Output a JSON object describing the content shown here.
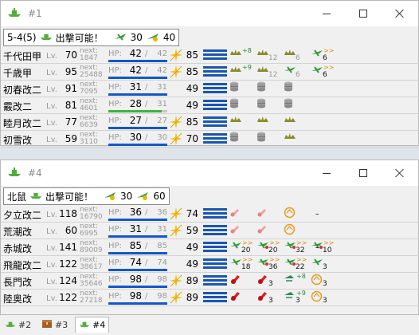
{
  "windows": [
    {
      "title": "#1",
      "fleet": {
        "area": "5-4(5)",
        "status": "出撃可能！",
        "air1": "30",
        "air2": "40"
      },
      "ships": [
        {
          "name": "千代田甲",
          "lv": "70",
          "next": "1847",
          "hp": "42",
          "maxhp": "42",
          "hpfrac": 1.0,
          "hpcolor": "#1457c8",
          "cond": "85",
          "sparkle": true,
          "slots": [
            {
              "icon": "fighter-olive-icon",
              "count": "",
              "bonus": "+8"
            },
            {
              "icon": "fighter-olive-icon",
              "count": "12",
              "grey": true
            },
            {
              "icon": "fighter-olive-icon",
              "count": "6",
              "grey": true
            },
            {
              "icon": "fighter-green-icon",
              "count": "6",
              "bonus": ">>",
              "orange": true
            }
          ]
        },
        {
          "name": "千歳甲",
          "lv": "95",
          "next": "25488",
          "hp": "42",
          "maxhp": "42",
          "hpfrac": 1.0,
          "hpcolor": "#1457c8",
          "cond": "85",
          "sparkle": true,
          "slots": [
            {
              "icon": "fighter-olive-icon",
              "count": "",
              "bonus": "+9"
            },
            {
              "icon": "fighter-olive-icon",
              "count": "12",
              "grey": true
            },
            {
              "icon": "fighter-green-icon",
              "count": "6",
              "grey": true
            },
            {
              "icon": "fighter-green-icon",
              "count": "6",
              "bonus": ">>",
              "orange": true
            }
          ]
        },
        {
          "name": "初春改二",
          "lv": "91",
          "next": "7095",
          "hp": "31",
          "maxhp": "31",
          "hpfrac": 1.0,
          "hpcolor": "#1457c8",
          "cond": "49",
          "sparkle": false,
          "slots": [
            {
              "icon": "drum-icon",
              "count": ""
            },
            {
              "icon": "drum-icon",
              "count": ""
            },
            {
              "icon": "drum-icon",
              "count": ""
            }
          ]
        },
        {
          "name": "霰改二",
          "lv": "81",
          "next": "4601",
          "hp": "28",
          "maxhp": "31",
          "hpfrac": 0.9,
          "hpcolor": "#3cb43c",
          "cond": "49",
          "sparkle": false,
          "slots": [
            {
              "icon": "drum-icon",
              "count": ""
            },
            {
              "icon": "drum-icon",
              "count": ""
            },
            {
              "icon": "drum-icon",
              "count": ""
            }
          ]
        },
        {
          "name": "睦月改二",
          "lv": "77",
          "next": "6639",
          "hp": "27",
          "maxhp": "27",
          "hpfrac": 1.0,
          "hpcolor": "#1457c8",
          "cond": "85",
          "sparkle": true,
          "slots": [
            {
              "icon": "fighter-olive-icon",
              "count": ""
            },
            {
              "icon": "fighter-olive-icon",
              "count": ""
            },
            {
              "icon": "fighter-olive-icon",
              "count": ""
            }
          ]
        },
        {
          "name": "初雪改",
          "lv": "59",
          "next": "3110",
          "hp": "30",
          "maxhp": "30",
          "hpfrac": 1.0,
          "hpcolor": "#1457c8",
          "cond": "70",
          "sparkle": true,
          "slots": [
            {
              "icon": "drum-icon",
              "count": ""
            },
            {
              "icon": "drum-icon",
              "count": ""
            },
            {
              "icon": "fighter-olive-icon",
              "count": ""
            }
          ]
        }
      ]
    },
    {
      "title": "#4",
      "fleet": {
        "area": "北鼠",
        "status": "出撃可能！",
        "air1": "30",
        "air2": "60"
      },
      "ships": [
        {
          "name": "夕立改二",
          "lv": "118",
          "next": "16790",
          "hp": "36",
          "maxhp": "36",
          "hpfrac": 1.0,
          "hpcolor": "#1457c8",
          "cond": "74",
          "sparkle": true,
          "slots": [
            {
              "icon": "gun-pink-icon",
              "count": ""
            },
            {
              "icon": "gun-pink-icon",
              "count": ""
            },
            {
              "icon": "torpedo-ring-icon",
              "count": ""
            }
          ],
          "dash": "-"
        },
        {
          "name": "荒潮改",
          "lv": "60",
          "next": "6995",
          "hp": "31",
          "maxhp": "31",
          "hpfrac": 1.0,
          "hpcolor": "#1457c8",
          "cond": "59",
          "sparkle": true,
          "slots": [
            {
              "icon": "gun-pink-icon",
              "count": ""
            },
            {
              "icon": "gun-pink-icon",
              "count": ""
            },
            {
              "icon": "torpedo-ring-icon",
              "count": ""
            }
          ]
        },
        {
          "name": "赤城改",
          "lv": "141",
          "next": "89009",
          "hp": "85",
          "maxhp": "85",
          "hpfrac": 1.0,
          "hpcolor": "#1457c8",
          "cond": "49",
          "sparkle": false,
          "slots": [
            {
              "icon": "fighter-green-icon",
              "count": "20",
              "bonus": ">>",
              "orange": true
            },
            {
              "icon": "bomber-green-icon",
              "count": "20",
              "bonus": ">>",
              "orange": true
            },
            {
              "icon": "bomber-green-icon",
              "count": "32",
              "bonus": ">>",
              "orange": true
            },
            {
              "icon": "bomber-green-icon",
              "count": "10",
              "bonus": ">>",
              "orange": true
            }
          ],
          "dash": "-"
        },
        {
          "name": "飛龍改二",
          "lv": "122",
          "next": "38617",
          "hp": "74",
          "maxhp": "74",
          "hpfrac": 1.0,
          "hpcolor": "#1457c8",
          "cond": "49",
          "sparkle": false,
          "slots": [
            {
              "icon": "fighter-green-icon",
              "count": "18",
              "bonus": ">>",
              "orange": true
            },
            {
              "icon": "bomber-green-icon",
              "count": "36",
              "bonus": ">>",
              "orange": true
            },
            {
              "icon": "bomber-green-icon",
              "count": "22",
              "bonus": ">>",
              "orange": true
            },
            {
              "icon": "fighter-green-icon",
              "count": "3"
            }
          ]
        },
        {
          "name": "長門改",
          "lv": "124",
          "next": "35646",
          "hp": "98",
          "maxhp": "98",
          "hpfrac": 1.0,
          "hpcolor": "#1457c8",
          "cond": "89",
          "sparkle": true,
          "slots": [
            {
              "icon": "gun-red-icon",
              "count": ""
            },
            {
              "icon": "gun-red-icon",
              "count": "3"
            },
            {
              "icon": "seaplane-icon",
              "count": "",
              "bonus": "+8"
            },
            {
              "icon": "torpedo-ring-icon",
              "count": "3"
            }
          ]
        },
        {
          "name": "陸奥改",
          "lv": "122",
          "next": "27218",
          "hp": "98",
          "maxhp": "98",
          "hpfrac": 1.0,
          "hpcolor": "#1457c8",
          "cond": "89",
          "sparkle": true,
          "slots": [
            {
              "icon": "gun-red-icon",
              "count": ""
            },
            {
              "icon": "gun-red-icon",
              "count": "3"
            },
            {
              "icon": "seaplane-icon",
              "count": "3",
              "bonus": "+9"
            },
            {
              "icon": "torpedo-ring-icon",
              "count": "3"
            }
          ]
        }
      ]
    }
  ],
  "labels": {
    "lv": "Lv.",
    "next": "next:",
    "hp": "HP:",
    "slash": "/"
  },
  "tabs": [
    {
      "label": "#2",
      "icon": "fleet-icon",
      "active": false
    },
    {
      "label": "#3",
      "icon": "chest-icon",
      "active": false
    },
    {
      "label": "#4",
      "icon": "fleet-icon",
      "active": true
    }
  ]
}
